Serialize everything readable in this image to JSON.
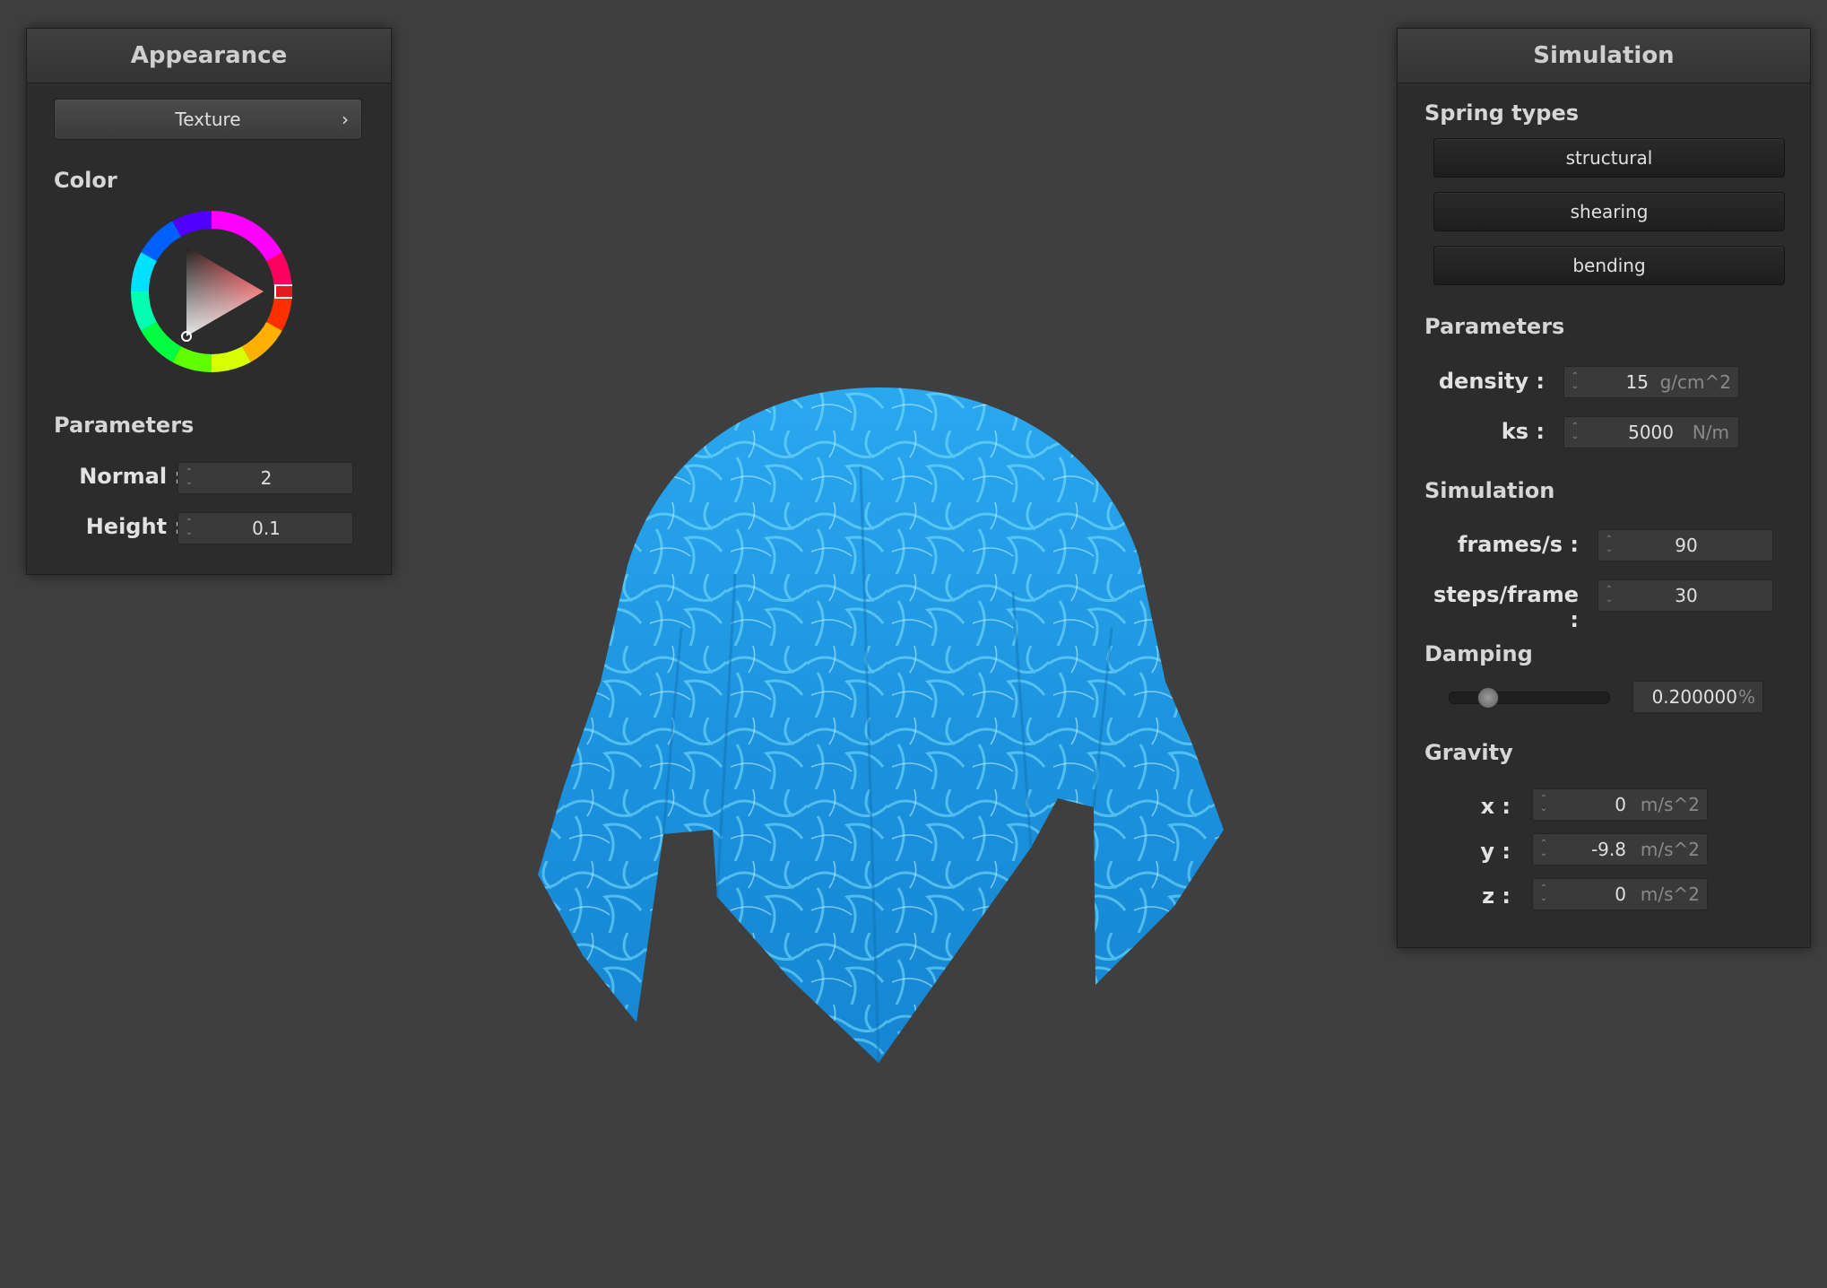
{
  "appearance": {
    "title": "Appearance",
    "texture_label": "Texture",
    "texture_arrow": "›",
    "color_label": "Color",
    "params_label": "Parameters",
    "normal": {
      "label": "Normal :",
      "value": "2"
    },
    "height": {
      "label": "Height :",
      "value": "0.1"
    },
    "selected_color": "#e6191e"
  },
  "simulation": {
    "title": "Simulation",
    "spring_types_label": "Spring types",
    "spring_types": [
      "structural",
      "shearing",
      "bending"
    ],
    "params_label": "Parameters",
    "density": {
      "label": "density :",
      "value": "15",
      "unit": "g/cm^2"
    },
    "ks": {
      "label": "ks :",
      "value": "5000",
      "unit": "N/m"
    },
    "sim_label": "Simulation",
    "fps": {
      "label": "frames/s :",
      "value": "90"
    },
    "steps": {
      "label": "steps/frame :",
      "value": "30"
    },
    "damping_label": "Damping",
    "damping": {
      "value": "0.200000",
      "unit": "%",
      "slider_fraction": 0.2
    },
    "gravity_label": "Gravity",
    "gx": {
      "label": "x :",
      "value": "0",
      "unit": "m/s^2"
    },
    "gy": {
      "label": "y :",
      "value": "-9.8",
      "unit": "m/s^2"
    },
    "gz": {
      "label": "z :",
      "value": "0",
      "unit": "m/s^2"
    }
  },
  "viewport": {
    "cloth_color": "#1e9fe6"
  }
}
